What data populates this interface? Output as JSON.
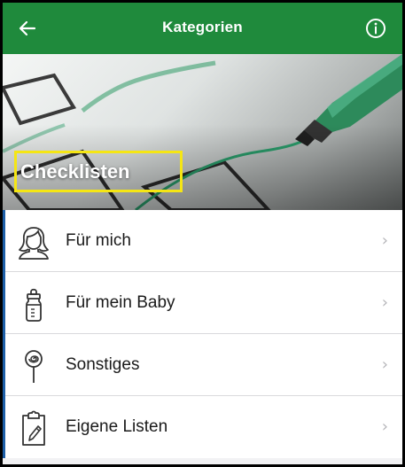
{
  "appbar": {
    "title": "Kategorien",
    "back_icon": "arrow-left-icon",
    "info_icon": "info-circle-icon"
  },
  "hero": {
    "label": "Checklisten",
    "highlight_color": "#f5e614"
  },
  "list": {
    "items": [
      {
        "label": "Für mich",
        "icon": "woman-face-icon"
      },
      {
        "label": "Für mein Baby",
        "icon": "baby-bottle-icon"
      },
      {
        "label": "Sonstiges",
        "icon": "lollipop-icon"
      },
      {
        "label": "Eigene Listen",
        "icon": "clipboard-pen-icon"
      }
    ],
    "chevron": "›"
  },
  "colors": {
    "appbar": "#1f8a3c",
    "list_accent": "#1d5fa8"
  }
}
